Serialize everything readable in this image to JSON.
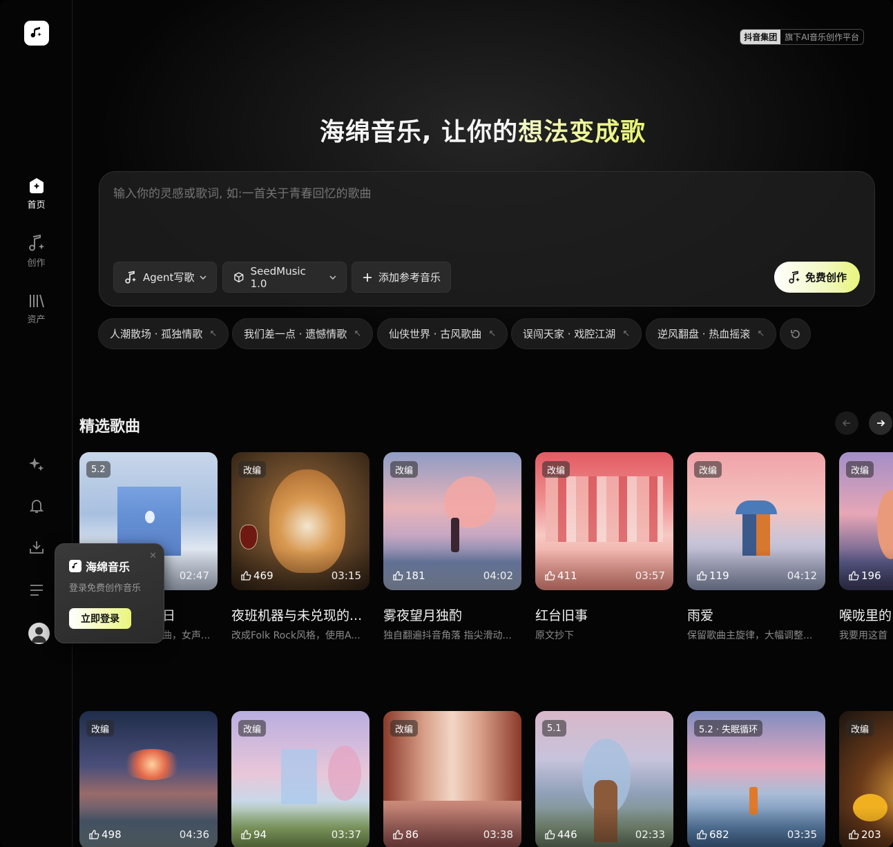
{
  "brand": {
    "group_badge": "抖音集团",
    "platform_badge": "旗下AI音乐创作平台"
  },
  "sidebar": {
    "items": [
      {
        "label": "首页"
      },
      {
        "label": "创作"
      },
      {
        "label": "资产"
      }
    ]
  },
  "hero": {
    "title_white": "海绵音乐, 让你的",
    "title_yellow": "想法变成歌"
  },
  "prompt": {
    "placeholder": "输入你的灵感或歌词, 如:一首关于青春回忆的歌曲",
    "mode_label": "Agent写歌",
    "model_label": "SeedMusic 1.0",
    "add_ref_label": "添加参考音乐",
    "create_label": "免费创作"
  },
  "suggestions": [
    "人潮散场 · 孤独情歌",
    "我们差一点 · 遗憾情歌",
    "仙侠世界 · 古风歌曲",
    "误闯天家 · 戏腔江湖",
    "逆风翻盘 · 热血摇滚"
  ],
  "featured": {
    "title": "精选歌曲",
    "row1": [
      {
        "tag": "5.2",
        "likes": "",
        "duration": "02:47",
        "title": "日",
        "subtitle": "曲，女声..."
      },
      {
        "tag": "改编",
        "likes": "469",
        "duration": "03:15",
        "title": "夜班机器与未兑现的...",
        "subtitle": "改成Folk Rock风格，使用A..."
      },
      {
        "tag": "改编",
        "likes": "181",
        "duration": "04:02",
        "title": "雾夜望月独酌",
        "subtitle": "独自翻遍抖音角落 指尖滑动..."
      },
      {
        "tag": "改编",
        "likes": "411",
        "duration": "03:57",
        "title": "红台旧事",
        "subtitle": "原文抄下"
      },
      {
        "tag": "改编",
        "likes": "119",
        "duration": "04:12",
        "title": "雨爱",
        "subtitle": "保留歌曲主旋律，大幅调整..."
      },
      {
        "tag": "改编",
        "likes": "196",
        "duration": "",
        "title": "喉咙里的",
        "subtitle": "我要用这首"
      }
    ],
    "row2": [
      {
        "tag": "改编",
        "likes": "498",
        "duration": "04:36"
      },
      {
        "tag": "改编",
        "likes": "94",
        "duration": "03:37"
      },
      {
        "tag": "改编",
        "likes": "86",
        "duration": "03:38"
      },
      {
        "tag": "5.1",
        "likes": "446",
        "duration": "02:33"
      },
      {
        "tag": "5.2 · 失眠循环",
        "likes": "682",
        "duration": "03:35"
      },
      {
        "tag": "改编",
        "likes": "203",
        "duration": ""
      }
    ]
  },
  "login_popup": {
    "title": "海绵音乐",
    "subtitle": "登录免费创作音乐",
    "button": "立即登录"
  },
  "colors": {
    "accent": "#e8f57a",
    "background": "#000000"
  }
}
